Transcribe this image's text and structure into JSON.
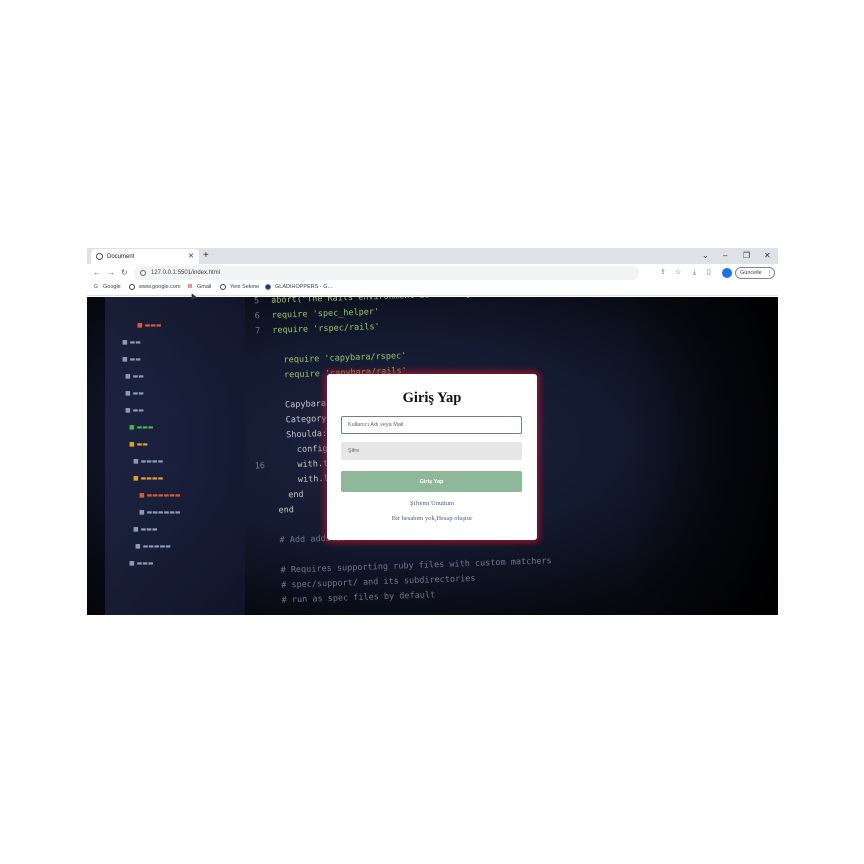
{
  "browser": {
    "tab_title": "Document",
    "url": "127.0.0.1:5501/index.html",
    "update_label": "Güncelle",
    "profile_initial": "",
    "bookmarks": [
      {
        "label": "Google",
        "icon": "google-icon",
        "color": "#4285f4"
      },
      {
        "label": "www.google.com",
        "icon": "globe-icon",
        "color": "#3c4043"
      },
      {
        "label": "Gmail",
        "icon": "gmail-icon",
        "color": "#ea4335"
      },
      {
        "label": "Yeni Sekme",
        "icon": "globe-icon",
        "color": "#3c4043"
      },
      {
        "label": "GLADIHOPPERS - G...",
        "icon": "gladihoppers-icon",
        "color": "#1a3a6a"
      }
    ]
  },
  "login": {
    "title": "Giriş Yap",
    "username_placeholder": "Kullanıcı Adı veya Mail",
    "password_placeholder": "Şifre",
    "submit_label": "Giriş Yap",
    "forgot_label": "Şifremi Unuttum",
    "register_label": "Bir hesabım yok,Hesap oluştur",
    "colors": {
      "button": "#8fb89a",
      "glow": "#aa1428",
      "link": "#4a5a8a"
    }
  },
  "background_code": {
    "lines": [
      {
        "num": "5",
        "text": "abort(\"The Rails environment is running in production!\")"
      },
      {
        "num": "6",
        "text": "require 'spec_helper'"
      },
      {
        "num": "7",
        "text": "require 'rspec/rails'"
      },
      {
        "num": "",
        "text": ""
      },
      {
        "num": "",
        "text": "  require 'capybara/rspec'"
      },
      {
        "num": "",
        "text": "  require 'capybara/rails'"
      },
      {
        "num": "",
        "text": ""
      },
      {
        "num": "",
        "text": "  Capybara.javascript_driver"
      },
      {
        "num": "",
        "text": "  Category.delete_all"
      },
      {
        "num": "",
        "text": "  Shoulda::Matchers"
      },
      {
        "num": "",
        "text": "    config.integrate"
      },
      {
        "num": "16",
        "text": "    with.test_framework"
      },
      {
        "num": "",
        "text": "    with.library"
      },
      {
        "num": "",
        "text": "  end"
      },
      {
        "num": "",
        "text": "end"
      },
      {
        "num": "",
        "text": ""
      },
      {
        "num": "",
        "text": "# Add additional requires below"
      },
      {
        "num": "",
        "text": ""
      },
      {
        "num": "",
        "text": "# Requires supporting ruby files with custom matchers"
      },
      {
        "num": "",
        "text": "# spec/support/ and its subdirectories"
      },
      {
        "num": "",
        "text": "# run as spec files by default"
      }
    ]
  }
}
